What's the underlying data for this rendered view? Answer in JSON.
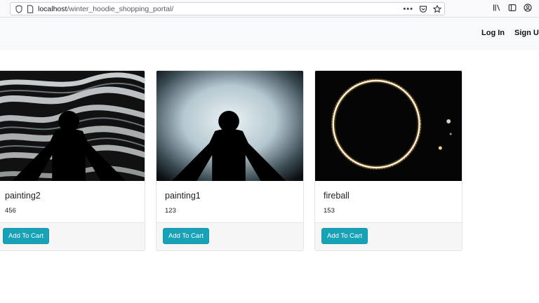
{
  "browser": {
    "url_host": "localhost",
    "url_path": "/winter_hoodie_shopping_portal/",
    "icons": {
      "tracking": "shield-icon",
      "page": "page-icon",
      "more": "more-actions-icon",
      "pocket": "pocket-icon",
      "bookmark": "star-icon",
      "library": "library-icon",
      "sidebar": "sidebar-icon",
      "account": "account-icon"
    }
  },
  "nav": {
    "login_label": "Log In",
    "signup_label": "Sign Up"
  },
  "products": [
    {
      "title": "painting2",
      "price": "456",
      "button_label": "Add To Cart",
      "image": "silhouette-white-waves"
    },
    {
      "title": "painting1",
      "price": "123",
      "button_label": "Add To Cart",
      "image": "silhouette-bright-haze"
    },
    {
      "title": "fireball",
      "price": "153",
      "button_label": "Add To Cart",
      "image": "ring-of-fire"
    }
  ],
  "colors": {
    "button": "#17a2b8",
    "navbar": "#f8f9fa",
    "card_footer": "#f6f6f7"
  }
}
